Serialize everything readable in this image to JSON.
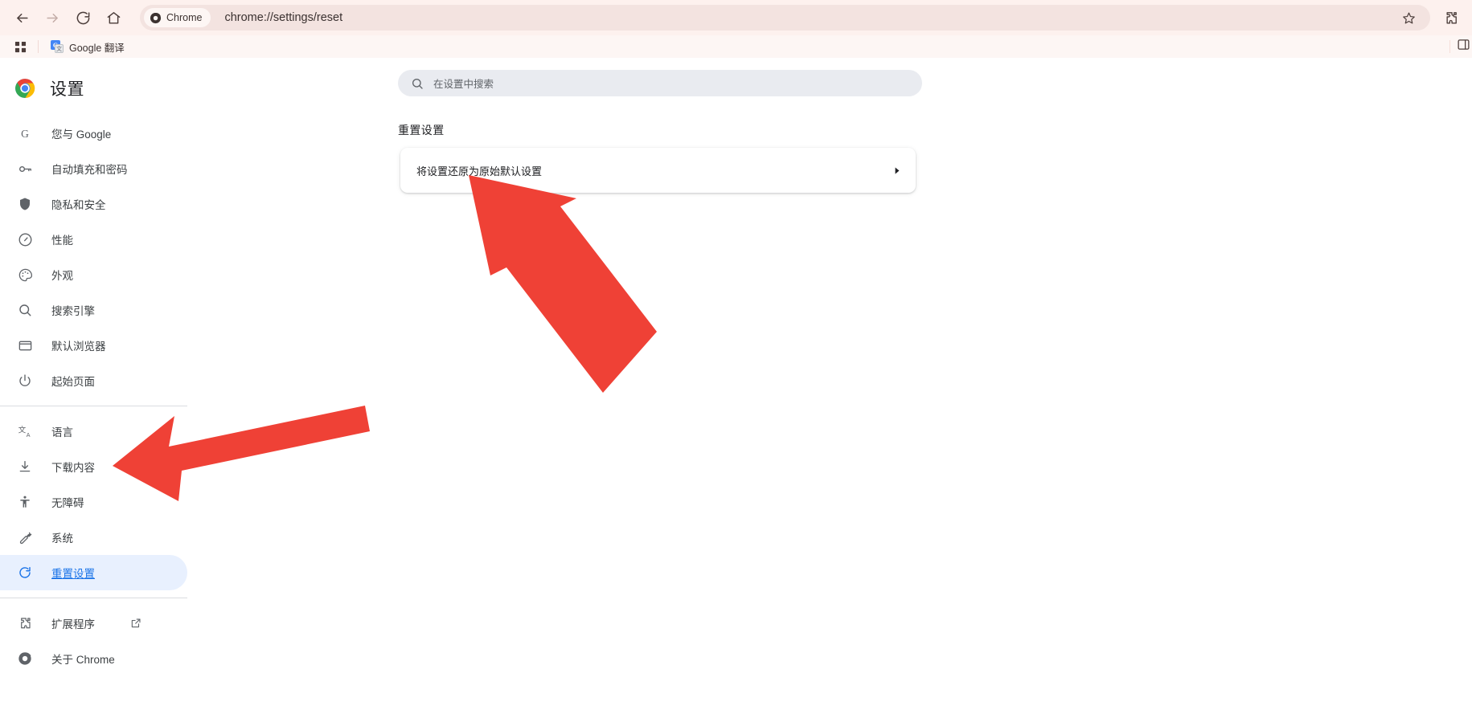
{
  "browser": {
    "nav": {
      "back_label": "后退",
      "forward_label": "前进",
      "reload_label": "重新加载",
      "home_label": "主页"
    },
    "omnibox": {
      "chip_label": "Chrome",
      "url": "chrome://settings/reset",
      "star_label": "将此标签页加入书签"
    },
    "toolbar_right": {
      "extensions_label": "扩展程序",
      "sidepanel_label": "侧边栏"
    },
    "bookmarks": {
      "apps_label": "应用",
      "items": [
        {
          "label": "Google 翻译",
          "icon": "google-translate-icon"
        }
      ]
    }
  },
  "settings": {
    "brand_title": "设置",
    "search": {
      "placeholder": "在设置中搜索",
      "value": ""
    },
    "sidebar": {
      "groups": [
        {
          "items": [
            {
              "label": "您与 Google",
              "icon": "google-g-icon",
              "selected": false
            },
            {
              "label": "自动填充和密码",
              "icon": "key-icon",
              "selected": false
            },
            {
              "label": "隐私和安全",
              "icon": "shield-icon",
              "selected": false
            },
            {
              "label": "性能",
              "icon": "speedometer-icon",
              "selected": false
            },
            {
              "label": "外观",
              "icon": "palette-icon",
              "selected": false
            },
            {
              "label": "搜索引擎",
              "icon": "search-icon",
              "selected": false
            },
            {
              "label": "默认浏览器",
              "icon": "browser-window-icon",
              "selected": false
            },
            {
              "label": "起始页面",
              "icon": "power-icon",
              "selected": false
            }
          ]
        },
        {
          "items": [
            {
              "label": "语言",
              "icon": "translate-icon",
              "selected": false
            },
            {
              "label": "下载内容",
              "icon": "download-icon",
              "selected": false
            },
            {
              "label": "无障碍",
              "icon": "accessibility-icon",
              "selected": false
            },
            {
              "label": "系统",
              "icon": "wrench-icon",
              "selected": false
            },
            {
              "label": "重置设置",
              "icon": "reset-icon",
              "selected": true
            }
          ]
        },
        {
          "items": [
            {
              "label": "扩展程序",
              "icon": "puzzle-icon",
              "selected": false,
              "external": true
            },
            {
              "label": "关于 Chrome",
              "icon": "chrome-icon",
              "selected": false
            }
          ]
        }
      ]
    },
    "main": {
      "section_title": "重置设置",
      "rows": [
        {
          "label": "将设置还原为原始默认设置",
          "chevron": "chevron-right-icon"
        }
      ]
    }
  },
  "annotations": {
    "arrow_color": "#ef4136",
    "arrows": [
      {
        "name": "arrow-to-reset-row",
        "points_to": "将设置还原为原始默认设置"
      },
      {
        "name": "arrow-to-sidebar-reset",
        "points_to": "重置设置"
      }
    ]
  },
  "colors": {
    "toolbar_bg": "#fdf1ee",
    "omnibox_bg": "#f3e3e0",
    "bookmark_bg": "#fdf6f4",
    "accent_blue": "#1a73e8",
    "selected_bg": "#e8f0fe",
    "search_bg": "#e9ebf0",
    "arrow_red": "#ef4136"
  }
}
